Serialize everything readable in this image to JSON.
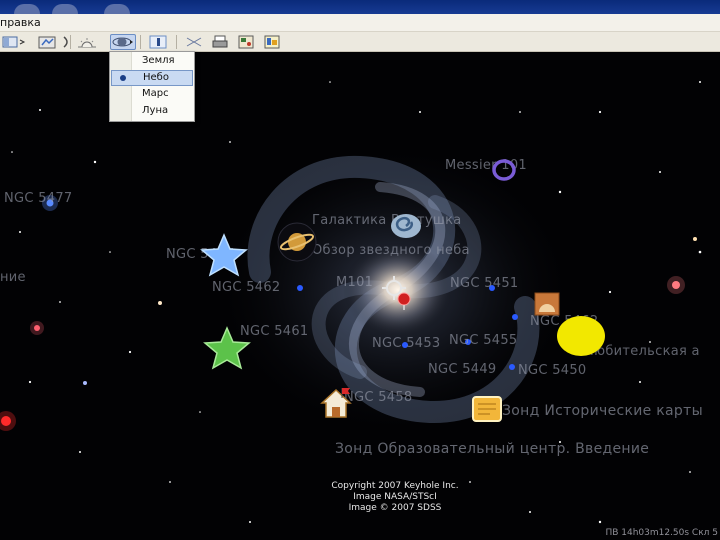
{
  "menu": {
    "label": "правка"
  },
  "dropdown": {
    "items": [
      {
        "label": "Земля",
        "selected": false
      },
      {
        "label": "Небо",
        "selected": true
      },
      {
        "label": "Марс",
        "selected": false
      },
      {
        "label": "Луна",
        "selected": false
      }
    ]
  },
  "labels": {
    "ngc5477": "NGC 5477",
    "messier101": "Messier 101",
    "galaxy_pinwheel": "Галактика Вертушка",
    "sky_overview": "Обзор звездного неба",
    "ngc_star": "NGC 5447",
    "ngc5462": "NGC 5462",
    "left_edge": "ние",
    "m101_center": "M101",
    "ngc5451": "NGC 5451",
    "ngc5461": "NGC 5461",
    "ngc_inner": "NGC 5453",
    "ngc5455_mid": "NGC 5455",
    "ngc5449": "NGC 5449",
    "ngc5450": "NGC 5450",
    "amateur": "Любительская а",
    "ngc5458": "NGC 5458",
    "historical_maps": "Зонд Исторические карты",
    "education_center": "Зонд Образовательный центр. Введение",
    "ngc_sun": "NGC 5462"
  },
  "copyright": {
    "line1": "Copyright 2007 Keyhole Inc.",
    "line2": "Image NASA/STScI",
    "line3": "Image © 2007 SDSS"
  },
  "status": {
    "coords": "ПВ 14h03m12.50s  Скл 5"
  },
  "icons": {
    "toolbar": [
      "hide-sidebar-icon",
      "placemark-icon",
      "path-icon",
      "sky-sun-icon",
      "planet-switch-icon",
      "ruler-icon",
      "email-icon",
      "print-icon",
      "map-view-icon"
    ],
    "map": [
      "saturn-icon",
      "spiral-galaxy-icon",
      "blue-star-icon",
      "green-star-icon",
      "purple-ring-icon",
      "target-icon",
      "red-pin-icon",
      "observatory-icon",
      "sun-icon",
      "home-icon",
      "note-icon"
    ]
  },
  "colors": {
    "accent": "#c6d6f0",
    "sun": "#f2e800",
    "ring": "#7a5cd6"
  }
}
